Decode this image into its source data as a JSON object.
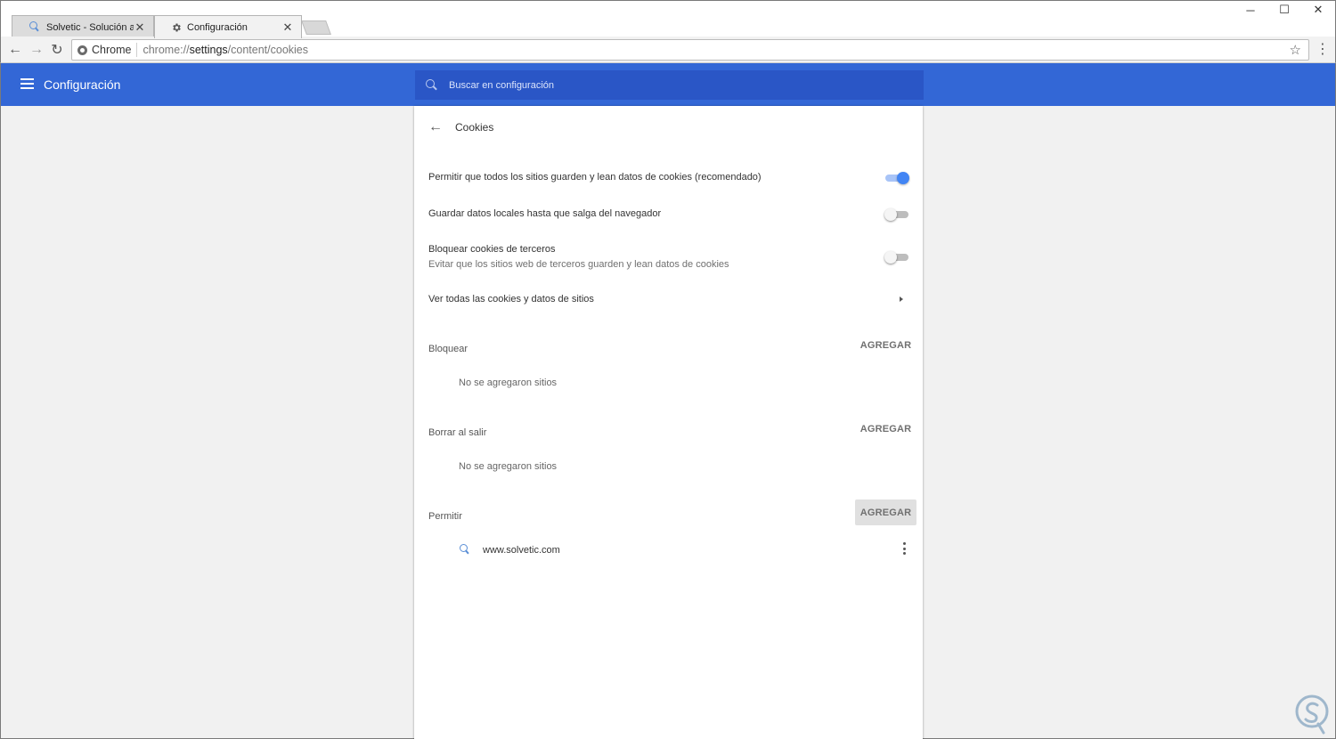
{
  "browser": {
    "tabs": [
      {
        "title": "Solvetic - Solución a los p",
        "icon": "solvetic-icon",
        "active": false
      },
      {
        "title": "Configuración",
        "icon": "gear-icon",
        "active": true
      }
    ],
    "tab_close": "✕",
    "window_controls": {
      "minimize": "─",
      "maximize": "☐",
      "close": "✕"
    },
    "nav": {
      "back": "←",
      "forward": "→",
      "reload": "↻"
    },
    "omnibox": {
      "chip_label": "Chrome",
      "url_prefix": "chrome://",
      "url_host": "settings",
      "url_path": "/content/cookies"
    },
    "star": "☆",
    "menu": "⋮"
  },
  "header": {
    "title": "Configuración",
    "search_placeholder": "Buscar en configuración",
    "accent": "#3367d6"
  },
  "subpage": {
    "back": "←",
    "title": "Cookies"
  },
  "settings": [
    {
      "label": "Permitir que todos los sitios guarden y lean datos de cookies (recomendado)",
      "on": true
    },
    {
      "label": "Guardar datos locales hasta que salga del navegador",
      "on": false
    },
    {
      "label": "Bloquear cookies de terceros",
      "secondary": "Evitar que los sitios web de terceros guarden y lean datos de cookies",
      "on": false
    }
  ],
  "see_all": {
    "label": "Ver todas las cookies y datos de sitios"
  },
  "sections": {
    "block": {
      "title": "Bloquear",
      "add_label": "AGREGAR",
      "empty": "No se agregaron sitios"
    },
    "clear_on_exit": {
      "title": "Borrar al salir",
      "add_label": "AGREGAR",
      "empty": "No se agregaron sitios"
    },
    "allow": {
      "title": "Permitir",
      "add_label": "AGREGAR",
      "sites": [
        "www.solvetic.com"
      ]
    }
  },
  "colors": {
    "toggle_on": "#4285f4",
    "page_background": "#f1f1f1"
  }
}
